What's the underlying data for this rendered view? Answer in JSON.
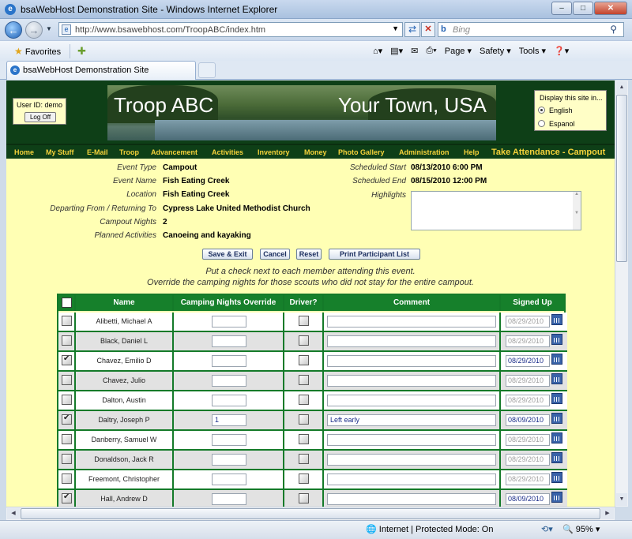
{
  "window": {
    "title": "bsaWebHost Demonstration Site - Windows Internet Explorer",
    "min": "–",
    "max": "□",
    "close": "✕"
  },
  "address": {
    "url": "http://www.bsawebhost.com/TroopABC/index.htm",
    "search_placeholder": "Bing"
  },
  "favorites": {
    "label": "Favorites"
  },
  "commands": [
    "Page ▾",
    "Safety ▾",
    "Tools ▾",
    "❓▾"
  ],
  "tab": {
    "label": "bsaWebHost Demonstration Site"
  },
  "site": {
    "user_label": "User ID: demo",
    "logoff": "Log Off",
    "banner_left": "Troop ABC",
    "banner_right": "Your Town, USA",
    "lang_title": "Display this site in...",
    "lang_english": "English",
    "lang_spanish": "Espanol"
  },
  "menu": [
    "Home",
    "My Stuff",
    "E-Mail",
    "Troop",
    "Advancement",
    "Activities",
    "Inventory",
    "Money",
    "Photo Gallery",
    "Administration",
    "Help"
  ],
  "menu_title": "Take Attendance - Campout",
  "event": {
    "type_label": "Event Type",
    "type": "Campout",
    "name_label": "Event Name",
    "name": "Fish Eating Creek",
    "location_label": "Location",
    "location": "Fish Eating Creek",
    "depart_label": "Departing From / Returning To",
    "depart": "Cypress Lake United Methodist Church",
    "nights_label": "Campout Nights",
    "nights": "2",
    "planned_label": "Planned Activities",
    "planned": "Canoeing and kayaking",
    "start_label": "Scheduled Start",
    "start": "08/13/2010 6:00 PM",
    "end_label": "Scheduled End",
    "end": "08/15/2010 12:00 PM",
    "highlights_label": "Highlights"
  },
  "buttons": {
    "save": "Save & Exit",
    "cancel": "Cancel",
    "reset": "Reset",
    "print": "Print Participant List"
  },
  "instructions": {
    "line1": "Put a check next to each member attending this event.",
    "line2": "Override the camping nights for those scouts who did not stay for the entire campout."
  },
  "grid": {
    "headers": {
      "name": "Name",
      "nights": "Camping Nights Override",
      "driver": "Driver?",
      "comment": "Comment",
      "signed": "Signed Up"
    },
    "rows": [
      {
        "name": "Alibetti, Michael A",
        "checked": false,
        "nights": "",
        "comment": "",
        "date": "08/29/2010",
        "date_active": false
      },
      {
        "name": "Black, Daniel L",
        "checked": false,
        "nights": "",
        "comment": "",
        "date": "08/29/2010",
        "date_active": false
      },
      {
        "name": "Chavez, Emilio D",
        "checked": true,
        "nights": "",
        "comment": "",
        "date": "08/29/2010",
        "date_active": true
      },
      {
        "name": "Chavez, Julio",
        "checked": false,
        "nights": "",
        "comment": "",
        "date": "08/29/2010",
        "date_active": false
      },
      {
        "name": "Dalton, Austin",
        "checked": false,
        "nights": "",
        "comment": "",
        "date": "08/29/2010",
        "date_active": false
      },
      {
        "name": "Daltry, Joseph P",
        "checked": true,
        "nights": "1",
        "comment": "Left early",
        "date": "08/09/2010",
        "date_active": true
      },
      {
        "name": "Danberry, Samuel W",
        "checked": false,
        "nights": "",
        "comment": "",
        "date": "08/29/2010",
        "date_active": false
      },
      {
        "name": "Donaldson, Jack R",
        "checked": false,
        "nights": "",
        "comment": "",
        "date": "08/29/2010",
        "date_active": false
      },
      {
        "name": "Freemont, Christopher",
        "checked": false,
        "nights": "",
        "comment": "",
        "date": "08/29/2010",
        "date_active": false
      },
      {
        "name": "Hall, Andrew D",
        "checked": true,
        "nights": "",
        "comment": "",
        "date": "08/09/2010",
        "date_active": true
      }
    ]
  },
  "status": {
    "zone": "Internet | Protected Mode: On",
    "zoom": "95%"
  },
  "colors": {
    "site_green": "#0e3f17",
    "menu_text": "#f5d23a",
    "form_bg": "#ffffb4",
    "grid_green": "#16802b",
    "row_alt": "#e2e2e2"
  }
}
